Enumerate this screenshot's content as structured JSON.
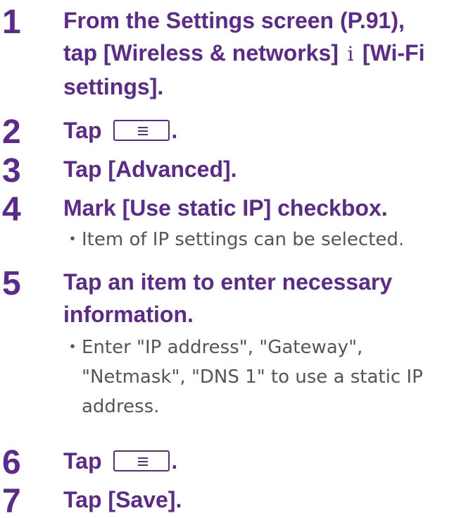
{
  "steps": [
    {
      "number": "1",
      "lines": [
        "From the Settings screen (P.91),",
        "tap [Wireless & networks]",
        "[Wi-Fi",
        "settings]."
      ],
      "arrow_glyph": "i"
    },
    {
      "number": "2",
      "text_before": "Tap",
      "icon": "menu-key-icon",
      "text_after": "."
    },
    {
      "number": "3",
      "text": "Tap [Advanced]."
    },
    {
      "number": "4",
      "text": "Mark [Use static IP] checkbox.",
      "notes": [
        "Item of IP settings can be selected."
      ]
    },
    {
      "number": "5",
      "lines": [
        "Tap an item to enter necessary",
        "information."
      ],
      "notes": [
        {
          "lines": [
            "Enter \"IP address\", \"Gateway\",",
            "\"Netmask\", \"DNS 1\" to use a static IP",
            "address."
          ]
        }
      ]
    },
    {
      "number": "6",
      "text_before": "Tap",
      "icon": "menu-key-icon",
      "text_after": "."
    },
    {
      "number": "7",
      "text": "Tap [Save]."
    }
  ],
  "bullet_char": "・",
  "colors": {
    "heading": "#5b2a8c",
    "note": "#555555",
    "background": "#ffffff"
  }
}
